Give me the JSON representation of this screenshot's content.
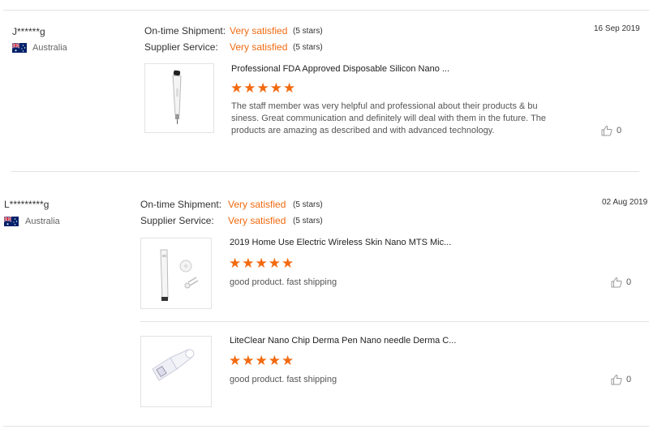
{
  "reviews": [
    {
      "reviewer": "J******g",
      "country": "Australia",
      "date": "16 Sep 2019",
      "shipment_label": "On-time Shipment:",
      "shipment_value": "Very satisfied",
      "shipment_stars": "(5 stars)",
      "service_label": "Supplier Service:",
      "service_value": "Very satisfied",
      "service_stars": "(5 stars)",
      "items": [
        {
          "title": "Professional FDA Approved Disposable Silicon Nano ...",
          "rating": 5,
          "text": "The staff member was very helpful and professional about their products & bu siness. Great communication and definitely will deal with them in the future. The products are amazing as described and with advanced technology.",
          "likes": "0",
          "thumbnail_icon": "pen-device-icon"
        }
      ]
    },
    {
      "reviewer": "L*********g",
      "country": "Australia",
      "date": "02 Aug 2019",
      "shipment_label": "On-time Shipment:",
      "shipment_value": "Very satisfied",
      "shipment_stars": "(5 stars)",
      "service_label": "Supplier Service:",
      "service_value": "Very satisfied",
      "service_stars": "(5 stars)",
      "items": [
        {
          "title": "2019 Home Use Electric Wireless Skin Nano MTS Mic...",
          "rating": 5,
          "text": "good product. fast shipping",
          "likes": "0",
          "thumbnail_icon": "wireless-pen-icon"
        },
        {
          "title": "LiteClear Nano Chip Derma Pen Nano needle Derma C...",
          "rating": 5,
          "text": "good product. fast shipping",
          "likes": "0",
          "thumbnail_icon": "nano-cartridge-icon"
        }
      ]
    }
  ],
  "colors": {
    "accent": "#f26a10",
    "divider": "#e3e3e3"
  }
}
